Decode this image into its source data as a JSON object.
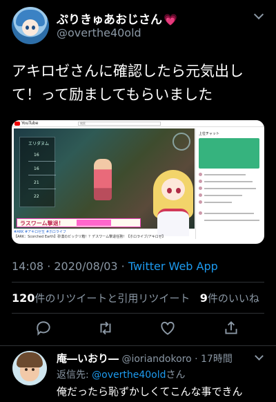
{
  "tweet": {
    "display_name": "ぷりきゅあおじさん",
    "display_name_emoji": "💗",
    "handle": "@overthe40old",
    "text": "アキロゼさんに確認したら元気出して！って励ましてもらいました",
    "timestamp": "14:08 · 2020/08/03 · ",
    "source": "Twitter Web App",
    "retweet_count": "120",
    "retweet_label": "件のリツイートと引用リツイート",
    "like_count": "9",
    "like_label": "件のいいね"
  },
  "media": {
    "site_logo_text": "YouTube",
    "search_placeholder": "検索",
    "game_panel_title": "エリダヌム",
    "game_panel_numbers": [
      "16",
      "16",
      "21",
      "22"
    ],
    "banner_text": "ラスワーム撃退！",
    "chat_title": "上位チャット",
    "video_caption_tag": "#ARK #アキロゼ生 #ホロライブ",
    "video_caption": "【ARK：Scorched Earth】砂漠のビックリ箱！？デスワーム撃退任務！【ホロライブ/アキロゼ】"
  },
  "actions": {
    "icons": [
      "reply-icon",
      "retweet-icon",
      "like-icon",
      "share-icon"
    ]
  },
  "reply": {
    "name": "庵―いおり―",
    "handle_time": " @ioriandokoro · 17時間",
    "reply_to_label": "返信先: ",
    "reply_to_handle": "@overthe40old",
    "reply_to_suffix": "さん",
    "text": "俺だったら恥ずかしくてこんな事できん"
  },
  "colors": {
    "background": "#000000",
    "accent": "#1d9bf0",
    "secondary_text": "#8b98a5"
  }
}
